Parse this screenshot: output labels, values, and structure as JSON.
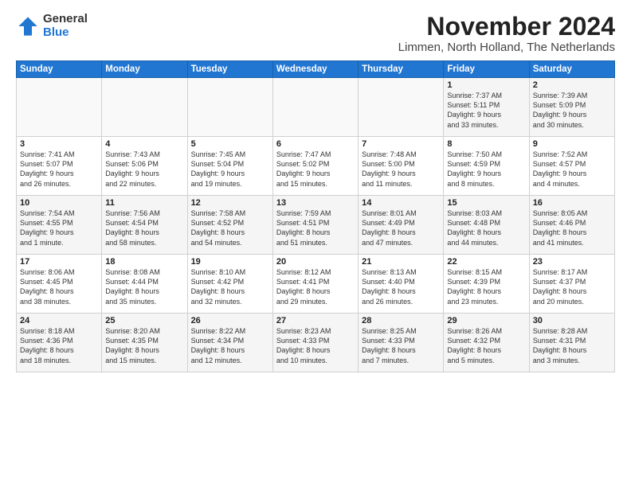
{
  "logo": {
    "general": "General",
    "blue": "Blue"
  },
  "header": {
    "title": "November 2024",
    "subtitle": "Limmen, North Holland, The Netherlands"
  },
  "weekdays": [
    "Sunday",
    "Monday",
    "Tuesday",
    "Wednesday",
    "Thursday",
    "Friday",
    "Saturday"
  ],
  "weeks": [
    [
      {
        "day": "",
        "info": ""
      },
      {
        "day": "",
        "info": ""
      },
      {
        "day": "",
        "info": ""
      },
      {
        "day": "",
        "info": ""
      },
      {
        "day": "",
        "info": ""
      },
      {
        "day": "1",
        "info": "Sunrise: 7:37 AM\nSunset: 5:11 PM\nDaylight: 9 hours\nand 33 minutes."
      },
      {
        "day": "2",
        "info": "Sunrise: 7:39 AM\nSunset: 5:09 PM\nDaylight: 9 hours\nand 30 minutes."
      }
    ],
    [
      {
        "day": "3",
        "info": "Sunrise: 7:41 AM\nSunset: 5:07 PM\nDaylight: 9 hours\nand 26 minutes."
      },
      {
        "day": "4",
        "info": "Sunrise: 7:43 AM\nSunset: 5:06 PM\nDaylight: 9 hours\nand 22 minutes."
      },
      {
        "day": "5",
        "info": "Sunrise: 7:45 AM\nSunset: 5:04 PM\nDaylight: 9 hours\nand 19 minutes."
      },
      {
        "day": "6",
        "info": "Sunrise: 7:47 AM\nSunset: 5:02 PM\nDaylight: 9 hours\nand 15 minutes."
      },
      {
        "day": "7",
        "info": "Sunrise: 7:48 AM\nSunset: 5:00 PM\nDaylight: 9 hours\nand 11 minutes."
      },
      {
        "day": "8",
        "info": "Sunrise: 7:50 AM\nSunset: 4:59 PM\nDaylight: 9 hours\nand 8 minutes."
      },
      {
        "day": "9",
        "info": "Sunrise: 7:52 AM\nSunset: 4:57 PM\nDaylight: 9 hours\nand 4 minutes."
      }
    ],
    [
      {
        "day": "10",
        "info": "Sunrise: 7:54 AM\nSunset: 4:55 PM\nDaylight: 9 hours\nand 1 minute."
      },
      {
        "day": "11",
        "info": "Sunrise: 7:56 AM\nSunset: 4:54 PM\nDaylight: 8 hours\nand 58 minutes."
      },
      {
        "day": "12",
        "info": "Sunrise: 7:58 AM\nSunset: 4:52 PM\nDaylight: 8 hours\nand 54 minutes."
      },
      {
        "day": "13",
        "info": "Sunrise: 7:59 AM\nSunset: 4:51 PM\nDaylight: 8 hours\nand 51 minutes."
      },
      {
        "day": "14",
        "info": "Sunrise: 8:01 AM\nSunset: 4:49 PM\nDaylight: 8 hours\nand 47 minutes."
      },
      {
        "day": "15",
        "info": "Sunrise: 8:03 AM\nSunset: 4:48 PM\nDaylight: 8 hours\nand 44 minutes."
      },
      {
        "day": "16",
        "info": "Sunrise: 8:05 AM\nSunset: 4:46 PM\nDaylight: 8 hours\nand 41 minutes."
      }
    ],
    [
      {
        "day": "17",
        "info": "Sunrise: 8:06 AM\nSunset: 4:45 PM\nDaylight: 8 hours\nand 38 minutes."
      },
      {
        "day": "18",
        "info": "Sunrise: 8:08 AM\nSunset: 4:44 PM\nDaylight: 8 hours\nand 35 minutes."
      },
      {
        "day": "19",
        "info": "Sunrise: 8:10 AM\nSunset: 4:42 PM\nDaylight: 8 hours\nand 32 minutes."
      },
      {
        "day": "20",
        "info": "Sunrise: 8:12 AM\nSunset: 4:41 PM\nDaylight: 8 hours\nand 29 minutes."
      },
      {
        "day": "21",
        "info": "Sunrise: 8:13 AM\nSunset: 4:40 PM\nDaylight: 8 hours\nand 26 minutes."
      },
      {
        "day": "22",
        "info": "Sunrise: 8:15 AM\nSunset: 4:39 PM\nDaylight: 8 hours\nand 23 minutes."
      },
      {
        "day": "23",
        "info": "Sunrise: 8:17 AM\nSunset: 4:37 PM\nDaylight: 8 hours\nand 20 minutes."
      }
    ],
    [
      {
        "day": "24",
        "info": "Sunrise: 8:18 AM\nSunset: 4:36 PM\nDaylight: 8 hours\nand 18 minutes."
      },
      {
        "day": "25",
        "info": "Sunrise: 8:20 AM\nSunset: 4:35 PM\nDaylight: 8 hours\nand 15 minutes."
      },
      {
        "day": "26",
        "info": "Sunrise: 8:22 AM\nSunset: 4:34 PM\nDaylight: 8 hours\nand 12 minutes."
      },
      {
        "day": "27",
        "info": "Sunrise: 8:23 AM\nSunset: 4:33 PM\nDaylight: 8 hours\nand 10 minutes."
      },
      {
        "day": "28",
        "info": "Sunrise: 8:25 AM\nSunset: 4:33 PM\nDaylight: 8 hours\nand 7 minutes."
      },
      {
        "day": "29",
        "info": "Sunrise: 8:26 AM\nSunset: 4:32 PM\nDaylight: 8 hours\nand 5 minutes."
      },
      {
        "day": "30",
        "info": "Sunrise: 8:28 AM\nSunset: 4:31 PM\nDaylight: 8 hours\nand 3 minutes."
      }
    ]
  ]
}
